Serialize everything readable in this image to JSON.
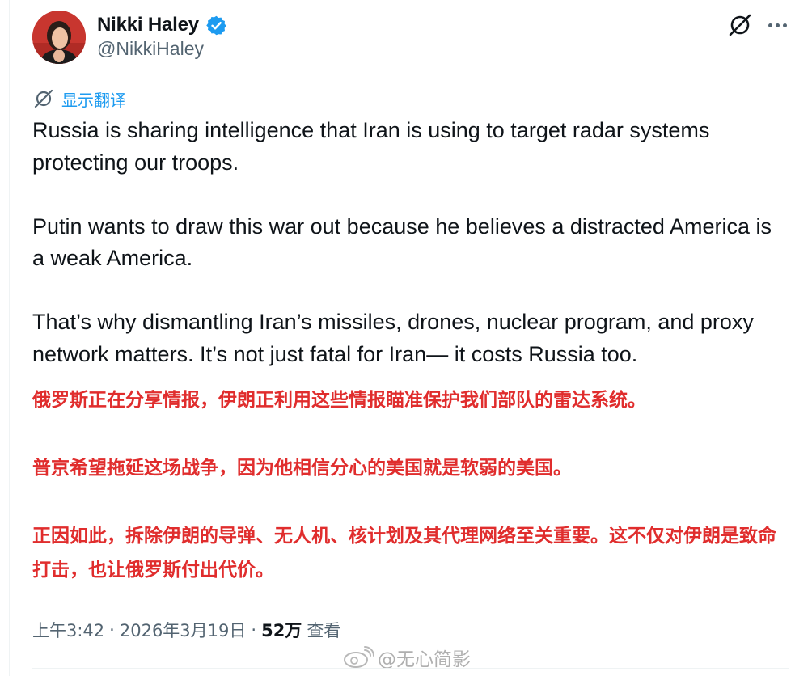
{
  "author": {
    "display_name": "Nikki Haley",
    "handle": "@NikkiHaley",
    "verified": true,
    "avatar_icon": "profile-photo"
  },
  "header_icons": {
    "grok": "grok-icon",
    "more": "more-icon"
  },
  "translate": {
    "icon": "translate-icon",
    "label": "显示翻译"
  },
  "tweet": {
    "paragraphs_en": [
      "Russia is sharing intelligence that Iran is using to target radar systems protecting our troops.",
      "Putin wants to draw this war out because he believes a distracted America is a weak America.",
      "That’s why dismantling Iran’s missiles, drones, nuclear program, and proxy network matters. It’s not just fatal for Iran— it costs Russia too."
    ],
    "paragraphs_zh": [
      "俄罗斯正在分享情报，伊朗正利用这些情报瞄准保护我们部队的雷达系统。",
      "普京希望拖延这场战争，因为他相信分心的美国就是软弱的美国。",
      "正因如此，拆除伊朗的导弹、无人机、核计划及其代理网络至关重要。这不仅对伊朗是致命打击，也让俄罗斯付出代价。"
    ]
  },
  "meta": {
    "time": "上午3:42",
    "separator": "·",
    "date": "2026年3月19日",
    "views_count": "52万",
    "views_label": "查看"
  },
  "watermark": {
    "text": "@无心简影"
  },
  "colors": {
    "accent_blue": "#1d9bf0",
    "translation_red": "#e02d2d",
    "secondary_text": "#536471",
    "primary_text": "#0f1419"
  }
}
